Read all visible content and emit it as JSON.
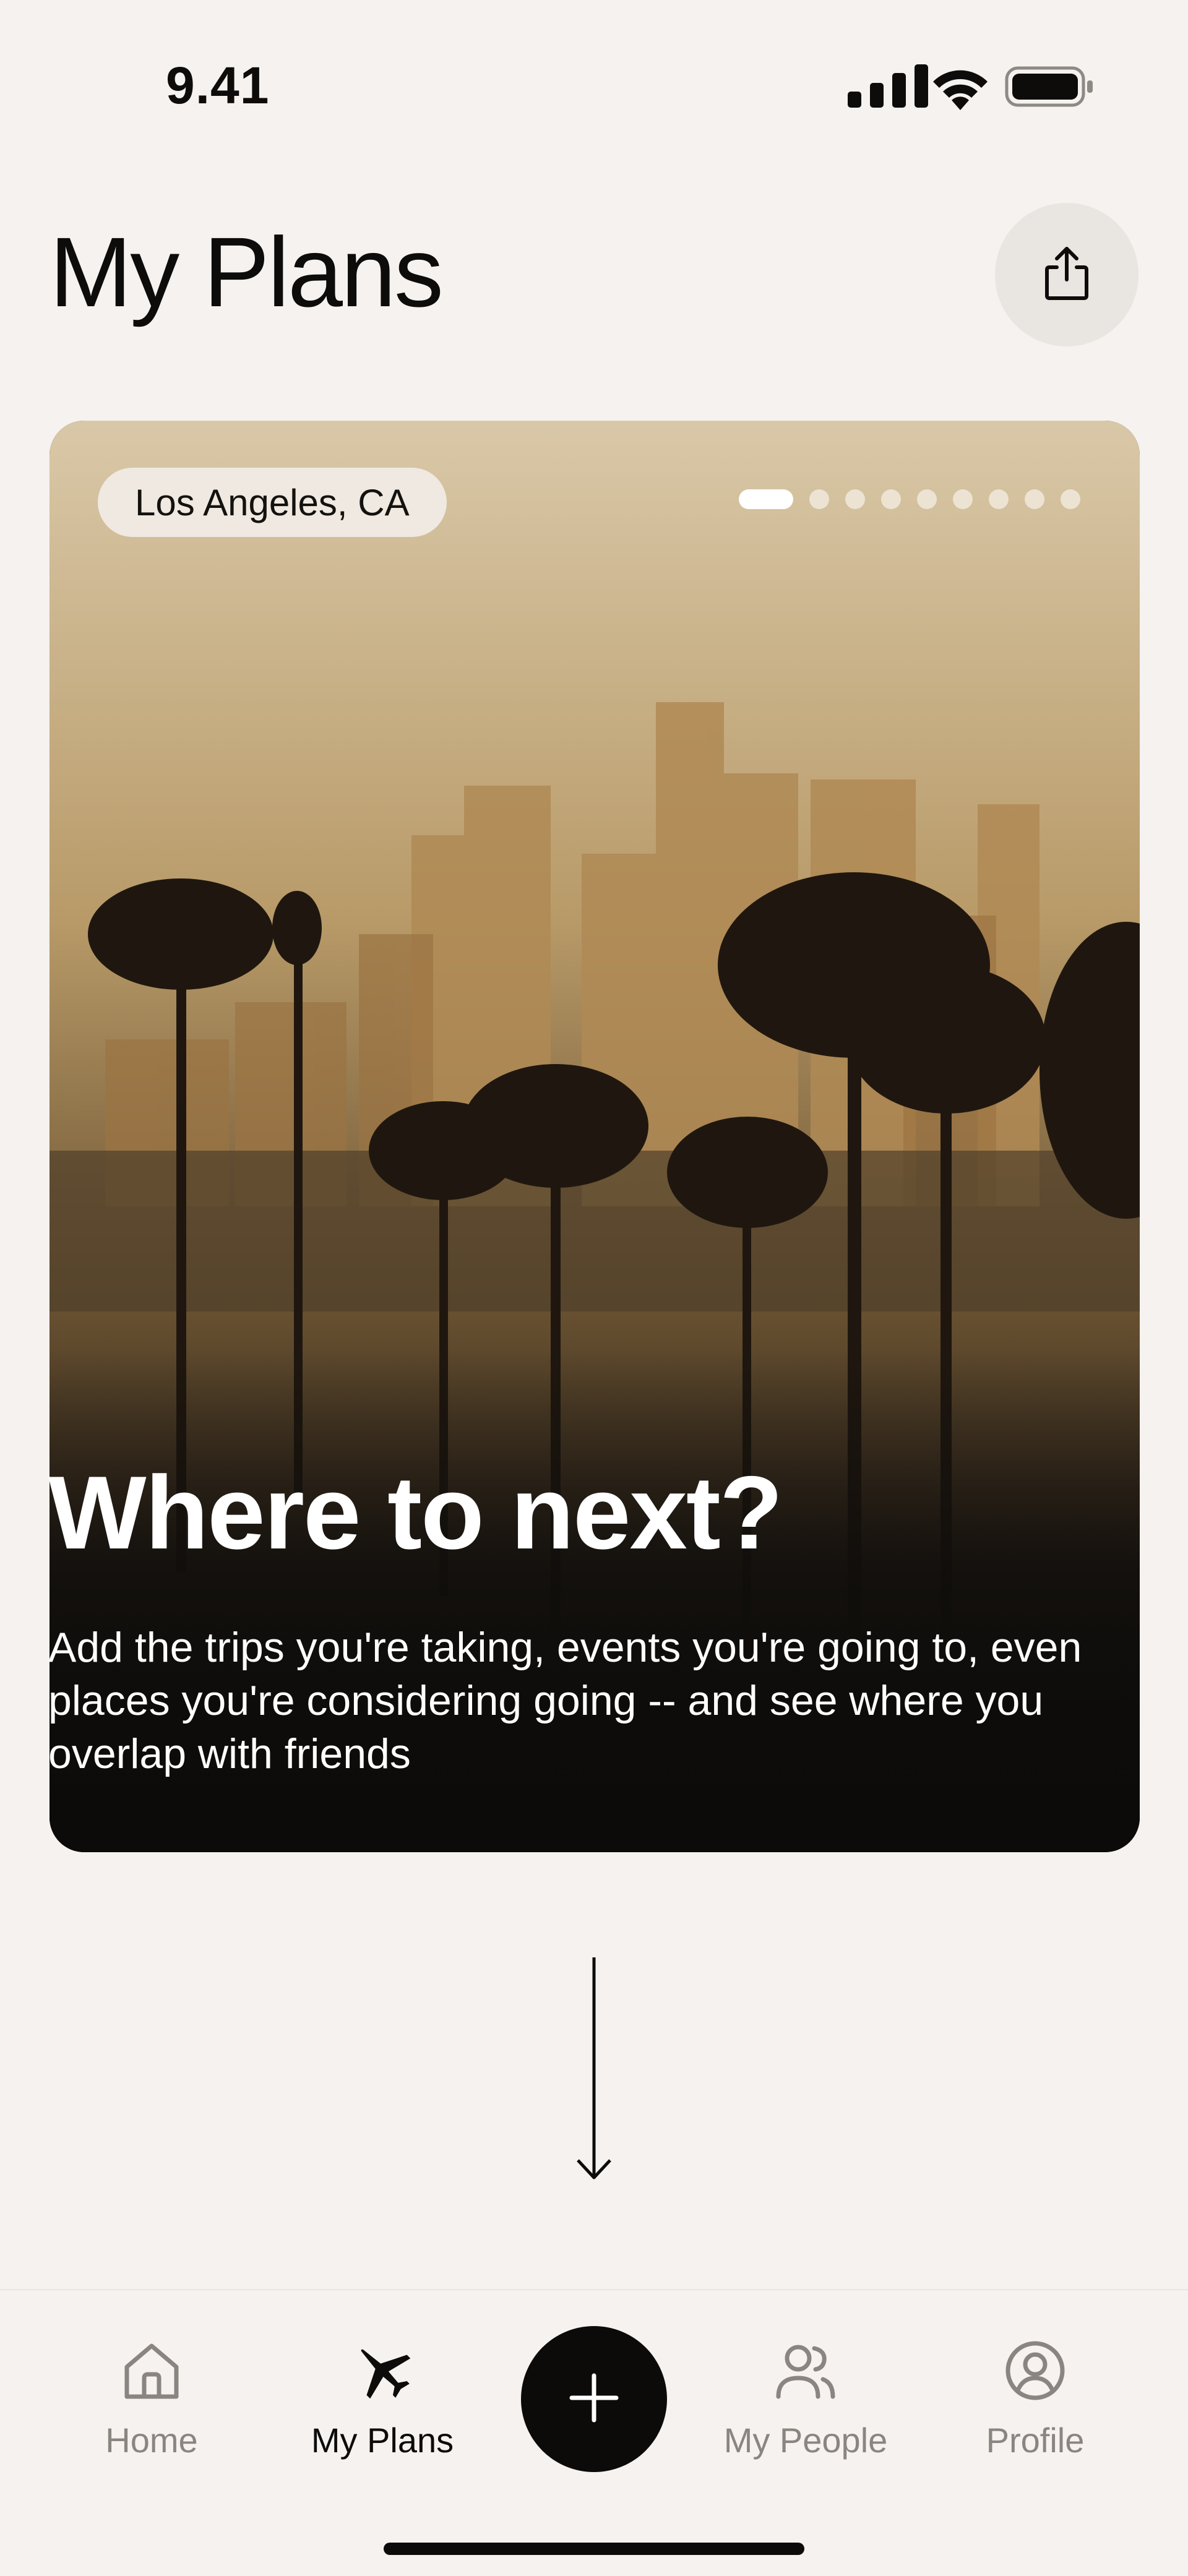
{
  "status_bar": {
    "time": "9.41",
    "icons": [
      "signal-icon",
      "wifi-icon",
      "battery-icon"
    ]
  },
  "header": {
    "title": "My Plans",
    "share_icon": "share-icon"
  },
  "hero": {
    "location": "Los Angeles, CA",
    "pager": {
      "total": 9,
      "active_index": 0
    },
    "heading": "Where to next?",
    "description": "Add the trips you're taking, events you're going to, even places you're considering going -- and see where you overlap with friends"
  },
  "tab_bar": {
    "items": [
      {
        "label": "Home",
        "icon": "home-icon",
        "active": false
      },
      {
        "label": "My Plans",
        "icon": "airplane-icon",
        "active": true
      },
      {
        "label": "My People",
        "icon": "people-icon",
        "active": false
      },
      {
        "label": "Profile",
        "icon": "profile-icon",
        "active": false
      }
    ],
    "add_icon": "plus-icon"
  },
  "colors": {
    "background": "#f5f2ef",
    "ink": "#0d0c0b",
    "muted": "#8a8580",
    "chip": "#efe9e1"
  }
}
